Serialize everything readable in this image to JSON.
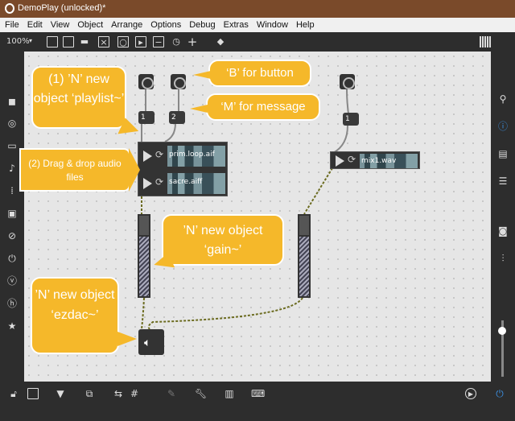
{
  "window": {
    "title": "DemoPlay (unlocked)*"
  },
  "menu": [
    "File",
    "Edit",
    "View",
    "Object",
    "Arrange",
    "Options",
    "Debug",
    "Extras",
    "Window",
    "Help"
  ],
  "toolbar": {
    "zoom": "100%"
  },
  "messages": {
    "m1": "1",
    "m2": "2",
    "m3": "1"
  },
  "playlist1": {
    "file1": "prim.loop.aif",
    "file2": "sacre.aiff"
  },
  "playlist2": {
    "file1": "mix1.wav"
  },
  "callouts": {
    "playlist": "(1) ’N’ new object ‘playlist~’",
    "drag": "(2) Drag & drop audio files",
    "button": "‘B’ for button",
    "message": "‘M’ for message",
    "gain": "’N’ new object ‘gain~’",
    "ezdac": "’N’ new object ‘ezdac~’"
  },
  "icons": {
    "left": [
      "cube-icon",
      "circle-icon",
      "rectangle-icon",
      "note-icon",
      "meter-icon",
      "image-icon",
      "paperclip-icon",
      "plug-icon",
      "v-icon",
      "h-icon",
      "star-icon"
    ],
    "right": [
      "search-icon",
      "info-icon",
      "book-icon",
      "list-icon",
      "camera-icon",
      "sliders-icon"
    ]
  }
}
